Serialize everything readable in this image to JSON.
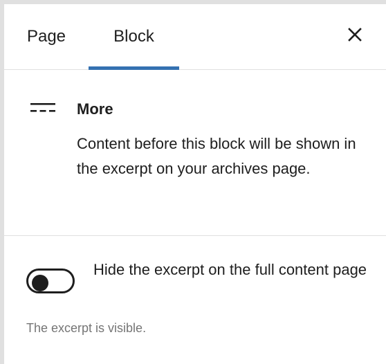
{
  "tabs": [
    {
      "label": "Page",
      "active": false
    },
    {
      "label": "Block",
      "active": true
    }
  ],
  "close_icon": "close-icon",
  "block": {
    "icon": "more-icon",
    "title": "More",
    "description": "Content before this block will be shown in the excerpt on your archives page."
  },
  "settings": {
    "toggle_label": "Hide the excerpt on the full content page",
    "toggle_on": false,
    "help_text": "The excerpt is visible."
  },
  "colors": {
    "accent": "#3471b1",
    "text": "#1e1e1e",
    "muted": "#757575",
    "border": "#e0e0e0"
  }
}
